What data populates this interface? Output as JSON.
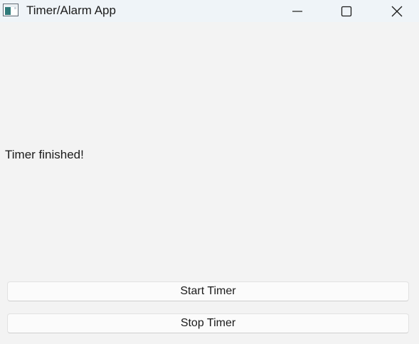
{
  "window": {
    "title": "Timer/Alarm App",
    "controls": {
      "minimize_icon": "minimize-icon",
      "maximize_icon": "maximize-icon",
      "close_icon": "close-icon"
    }
  },
  "main": {
    "status_text": "Timer finished!",
    "start_label": "Start Timer",
    "stop_label": "Stop Timer"
  },
  "colors": {
    "titlebar_bg": "#eff4f8",
    "window_bg": "#f3f3f3",
    "button_bg": "#fbfbfb",
    "text": "#1b1b1b"
  }
}
